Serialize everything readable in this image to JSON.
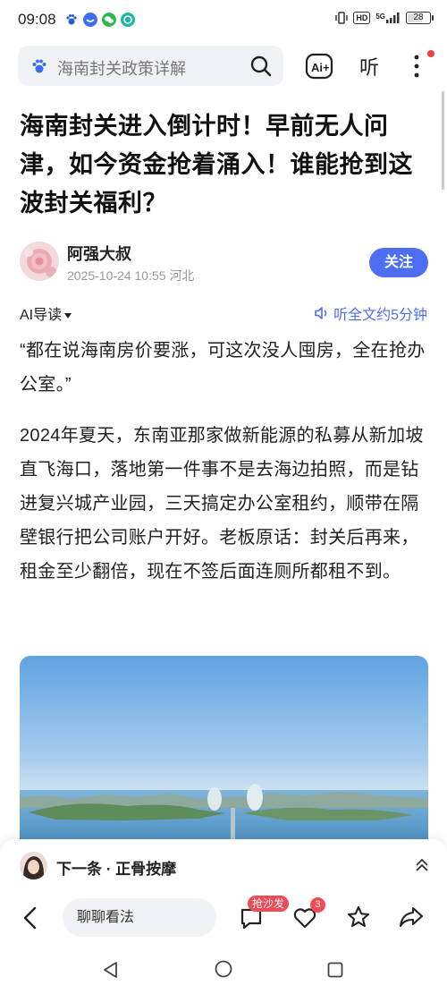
{
  "status_bar": {
    "time": "09:08",
    "network": "HD",
    "signal": "5G",
    "battery": "28"
  },
  "search": {
    "placeholder": "海南封关政策详解"
  },
  "toolbar": {
    "ai_label": "Ai+",
    "listen_label": "听"
  },
  "article": {
    "title": "海南封关进入倒计时！早前无人问津，如今资金抢着涌入！谁能抢到这波封关福利？",
    "author": {
      "name": "阿强大叔",
      "meta": "2025-10-24 10:55  河北",
      "follow_label": "关注"
    },
    "ai_guide_label": "AI导读",
    "listen_full_label": "听全文约5分钟",
    "paragraphs": [
      "“都在说海南房价要涨，可这次没人囤房，全在抢办公室。”",
      "2024年夏天，东南亚那家做新能源的私募从新加坡直飞海口，落地第一件事不是去海边拍照，而是钻进复兴城产业园，三天搞定办公室租约，顺带在隔壁银行把公司账户开好。老板原话：封关后再来，租金至少翻倍，现在不签后面连厕所都租不到。"
    ]
  },
  "next_item": {
    "label": "下一条 · 正骨按摩"
  },
  "bottom_bar": {
    "comment_placeholder": "聊聊看法",
    "sofa_badge": "抢沙发",
    "like_count": "3"
  },
  "colors": {
    "accent": "#4e6ef2",
    "badge_red": "#f24a55"
  }
}
